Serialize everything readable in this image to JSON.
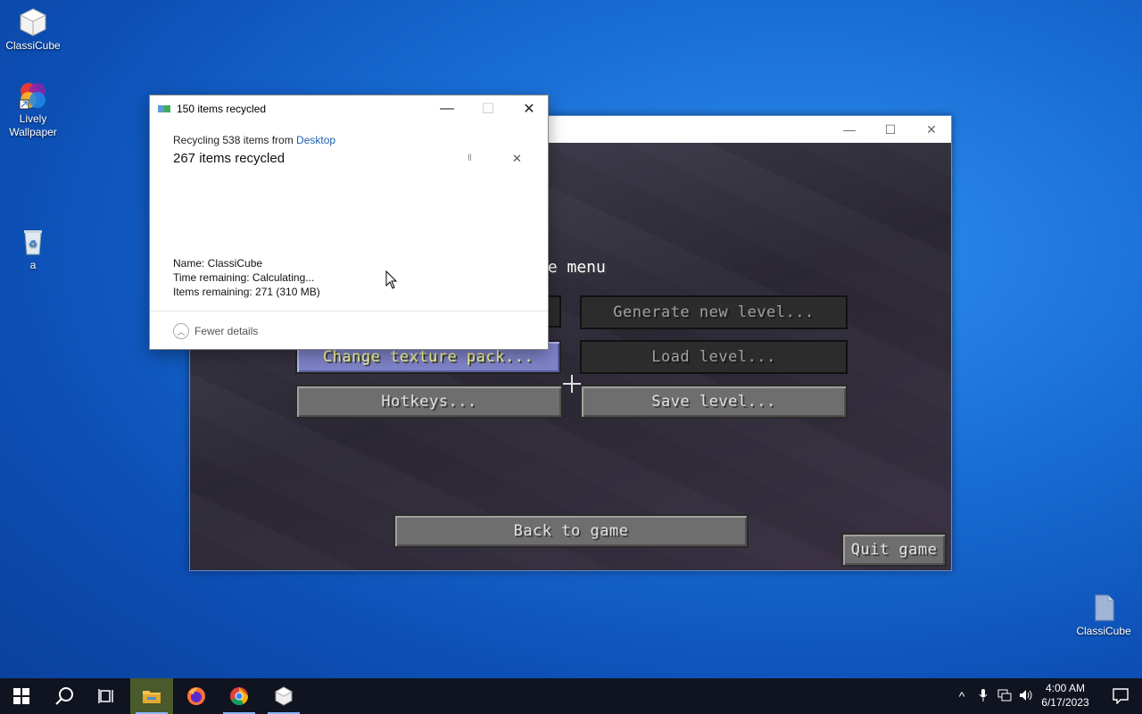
{
  "desktop": {
    "icons": [
      {
        "label": "ClassiCube"
      },
      {
        "label": "Lively Wallpaper"
      },
      {
        "label": "a"
      },
      {
        "label": "ClassiCube"
      }
    ]
  },
  "game_window": {
    "controls": {
      "minimize": "—",
      "maximize": "☐",
      "close": "✕"
    },
    "menu_title": "me menu",
    "buttons": {
      "generate": "Generate new level...",
      "texture": "Change texture pack...",
      "load": "Load level...",
      "hotkeys": "Hotkeys...",
      "save": "Save level...",
      "back": "Back to game",
      "quit": "Quit game"
    }
  },
  "dialog": {
    "title": "150 items recycled",
    "controls": {
      "minimize": "—",
      "maximize": "☐",
      "close": "✕"
    },
    "line1_prefix": "Recycling 538 items from ",
    "line1_link": "Desktop",
    "big_status": "267 items recycled",
    "pause_glyph": "II",
    "cancel_glyph": "✕",
    "details": {
      "name": "Name:  ClassiCube",
      "time": "Time remaining:  Calculating...",
      "items": "Items remaining:  271 (310 MB)"
    },
    "fewer_details": "Fewer details",
    "fewer_glyph": "︿"
  },
  "taskbar": {
    "start_glyph": "⊞",
    "search_glyph": "○",
    "clock_time": "4:00 AM",
    "clock_date": "6/17/2023",
    "tray_glyphs": {
      "chevron": "^",
      "mic": "🎤",
      "network": "⊡",
      "volume": "🔊",
      "notification": "▢"
    }
  },
  "colors": {
    "accent": "#1a5fb4",
    "desktop": "#1a6fd6",
    "taskbar": "#101420",
    "mc_hover": "#7f84c9"
  }
}
